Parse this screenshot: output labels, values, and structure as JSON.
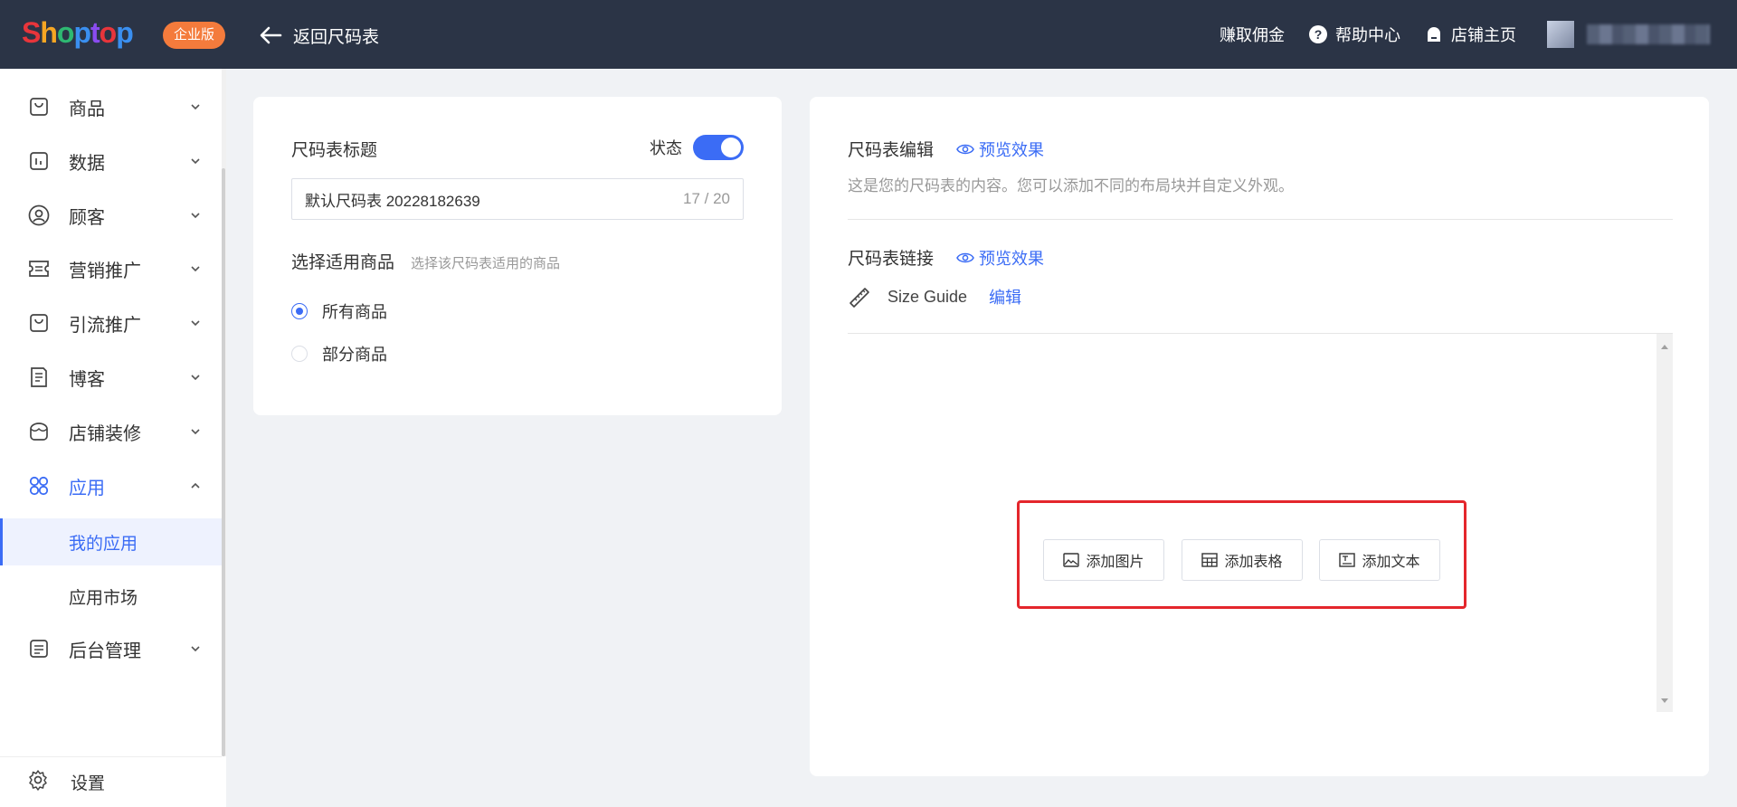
{
  "topbar": {
    "logo": "Shoptop",
    "logo_colors": [
      "#e8353b",
      "#f6a623",
      "#2eb872",
      "#3a8ff0",
      "#8a4cf0",
      "#e8353b",
      "#3a8ff0"
    ],
    "edition_badge": "企业版",
    "back_label": "返回尺码表",
    "links": [
      {
        "label": "赚取佣金",
        "icon": "none"
      },
      {
        "label": "帮助中心",
        "icon": "help-icon"
      },
      {
        "label": "店铺主页",
        "icon": "store-icon"
      }
    ]
  },
  "sidebar": {
    "items": [
      {
        "label": "商品",
        "icon": "product-icon"
      },
      {
        "label": "数据",
        "icon": "chart-icon"
      },
      {
        "label": "顾客",
        "icon": "user-icon"
      },
      {
        "label": "营销推广",
        "icon": "ticket-icon"
      },
      {
        "label": "引流推广",
        "icon": "bag-icon"
      },
      {
        "label": "博客",
        "icon": "document-icon"
      },
      {
        "label": "店铺装修",
        "icon": "storefront-icon"
      },
      {
        "label": "应用",
        "icon": "apps-icon",
        "expanded": true
      },
      {
        "label": "后台管理",
        "icon": "list-icon"
      }
    ],
    "sub_items": [
      {
        "label": "我的应用",
        "active": true
      },
      {
        "label": "应用市场",
        "active": false
      }
    ],
    "settings_label": "设置"
  },
  "left_card": {
    "title_label": "尺码表标题",
    "status_label": "状态",
    "status_on": true,
    "title_value": "默认尺码表 20228182639",
    "title_count": "17 / 20",
    "apply_label": "选择适用商品",
    "apply_hint": "选择该尺码表适用的商品",
    "options": [
      {
        "label": "所有商品",
        "checked": true
      },
      {
        "label": "部分商品",
        "checked": false
      }
    ]
  },
  "right_card": {
    "editor_label": "尺码表编辑",
    "preview_label": "预览效果",
    "description": "这是您的尺码表的内容。您可以添加不同的布局块并自定义外观。",
    "link_label": "尺码表链接",
    "link_preview_label": "预览效果",
    "guide_text": "Size Guide",
    "edit_label": "编辑",
    "buttons": [
      {
        "label": "添加图片",
        "icon": "image-icon"
      },
      {
        "label": "添加表格",
        "icon": "table-icon"
      },
      {
        "label": "添加文本",
        "icon": "text-icon"
      }
    ]
  },
  "colors": {
    "accent": "#3b6cf5",
    "topbar": "#2b3446",
    "badge": "#f47b3c",
    "highlight": "#e4262c"
  }
}
